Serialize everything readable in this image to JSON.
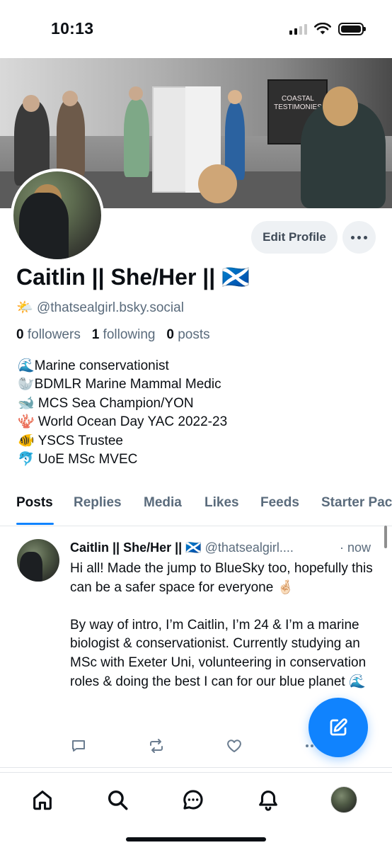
{
  "status_bar": {
    "time": "10:13"
  },
  "banner": {
    "screen_text": "COASTAL TESTIMONIES"
  },
  "profile": {
    "display_name": "Caitlin || She/Her || 🏴󠁧󠁢󠁳󠁣󠁴󠁿",
    "handle_emoji": "🌤️",
    "handle": "@thatsealgirl.bsky.social",
    "followers_count": "0",
    "followers_label": "followers",
    "following_count": "1",
    "following_label": "following",
    "posts_count": "0",
    "posts_label": "posts",
    "bio_lines": [
      "🌊Marine conservationist",
      "🦭BDMLR Marine Mammal Medic",
      "🐋 MCS Sea Champion/YON",
      "🪸 World Ocean Day YAC 2022-23",
      "🐠 YSCS Trustee",
      "🐬 UoE MSc MVEC"
    ]
  },
  "actions": {
    "edit_profile": "Edit Profile"
  },
  "tabs": [
    "Posts",
    "Replies",
    "Media",
    "Likes",
    "Feeds",
    "Starter Packs"
  ],
  "post": {
    "author": "Caitlin || She/Her || 🏴󠁧󠁢󠁳󠁣󠁴󠁿",
    "handle": "@thatsealgirl....",
    "time": "· now",
    "paragraph1": "Hi all! Made the jump to BlueSky too, hopefully this can be a safer space for everyone 🤞🏻",
    "paragraph2": "By way of intro, I’m Caitlin, I’m 24 & I’m a marine biologist & conservationist. Currently studying an MSc with Exeter Uni, volunteering in conservation roles & doing the best I can for our blue planet 🌊"
  },
  "colors": {
    "accent": "#1083fe",
    "muted_text": "#5a6b7c",
    "button_bg": "#eef1f4"
  },
  "icons": {
    "nav": [
      "home-icon",
      "search-icon",
      "chat-icon",
      "bell-icon",
      "profile-avatar"
    ],
    "post_actions": [
      "reply-icon",
      "repost-icon",
      "like-icon",
      "more-icon"
    ],
    "fab": "compose-icon"
  }
}
